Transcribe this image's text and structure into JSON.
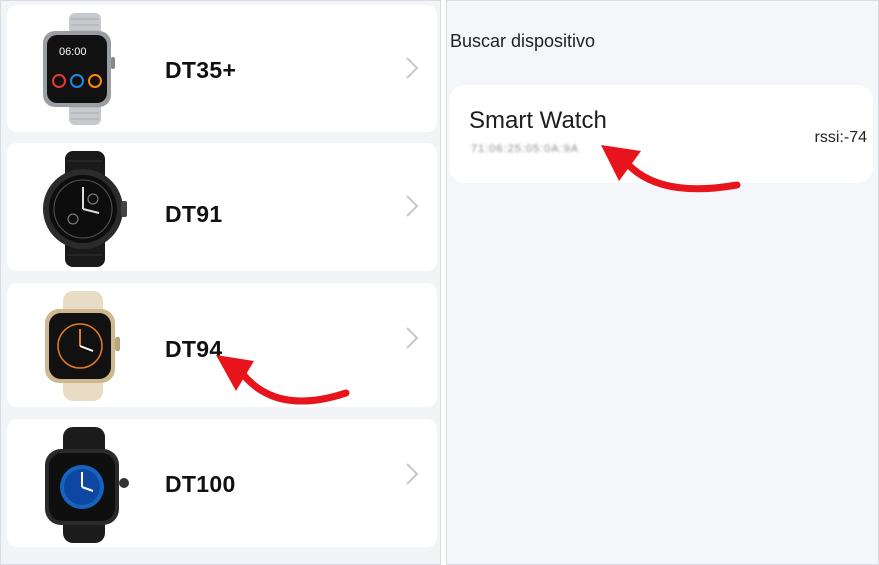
{
  "device_list": {
    "items": [
      {
        "name": "DT35+",
        "image_icon": "mesh-strap-square-watch-icon",
        "chevron_icon": "chevron-right-icon"
      },
      {
        "name": "DT91",
        "image_icon": "round-black-watch-icon",
        "chevron_icon": "chevron-right-icon"
      },
      {
        "name": "DT94",
        "image_icon": "beige-square-watch-icon",
        "chevron_icon": "chevron-right-icon"
      },
      {
        "name": "DT100",
        "image_icon": "black-square-watch-icon",
        "chevron_icon": "chevron-right-icon"
      }
    ]
  },
  "search": {
    "title": "Buscar dispositivo",
    "results": [
      {
        "name": "Smart Watch",
        "mac": "71:06:25:05:0A:9A",
        "rssi": "rssi:-74"
      }
    ]
  },
  "colors": {
    "arrow": "#e8141b",
    "card_background": "#ffffff",
    "panel_background": "#f2f4f8",
    "chevron": "#c9c9c9"
  }
}
